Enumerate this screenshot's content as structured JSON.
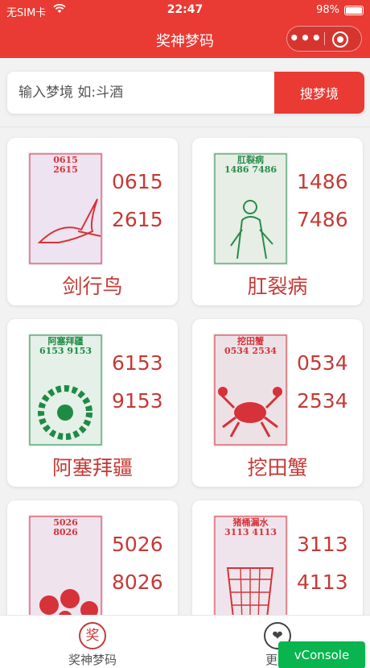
{
  "status_bar": {
    "carrier": "无SIM卡",
    "time": "22:47",
    "battery": "98%"
  },
  "nav": {
    "title": "奖神梦码",
    "more_label": "•••"
  },
  "search": {
    "placeholder": "输入梦境 如:斗酒",
    "value": "",
    "button_label": "搜梦境"
  },
  "cards": [
    {
      "name": "剑行鸟",
      "num1": "0615",
      "num2": "2615",
      "thumb_nums": [
        "0615",
        "2615"
      ],
      "thumb_color": "#d6323a",
      "thumb_bg": "#eee3f0",
      "icon": "bird"
    },
    {
      "name": "肛裂病",
      "num1": "1486",
      "num2": "7486",
      "thumb_nums": [
        "肛裂病",
        "1486 7486"
      ],
      "thumb_color": "#2a8a4a",
      "thumb_bg": "#e6eee6",
      "icon": "man"
    },
    {
      "name": "阿塞拜疆",
      "num1": "6153",
      "num2": "9153",
      "thumb_nums": [
        "阿塞拜疆",
        "6153 9153"
      ],
      "thumb_color": "#1f8a45",
      "thumb_bg": "#e4f0e8",
      "icon": "wreath"
    },
    {
      "name": "挖田蟹",
      "num1": "0534",
      "num2": "2534",
      "thumb_nums": [
        "挖田蟹",
        "0534 2534"
      ],
      "thumb_color": "#d6323a",
      "thumb_bg": "#ece2e6",
      "icon": "crab"
    },
    {
      "name": "",
      "num1": "5026",
      "num2": "8026",
      "thumb_nums": [
        "5026",
        "8026"
      ],
      "thumb_color": "#d6323a",
      "thumb_bg": "#efe3ee",
      "icon": "pills"
    },
    {
      "name": "",
      "num1": "3113",
      "num2": "4113",
      "thumb_nums": [
        "猪桶漏水",
        "3113 4113"
      ],
      "thumb_color": "#d6323a",
      "thumb_bg": "#f0e4ec",
      "icon": "bucket"
    }
  ],
  "tabs": [
    {
      "label": "奖神梦码",
      "icon": "奖"
    },
    {
      "label": "更多",
      "icon": "heart"
    }
  ],
  "vconsole": {
    "label": "vConsole"
  },
  "colors": {
    "accent": "#e93a33",
    "number_text": "#c53a36",
    "vconsole": "#08b54f"
  }
}
